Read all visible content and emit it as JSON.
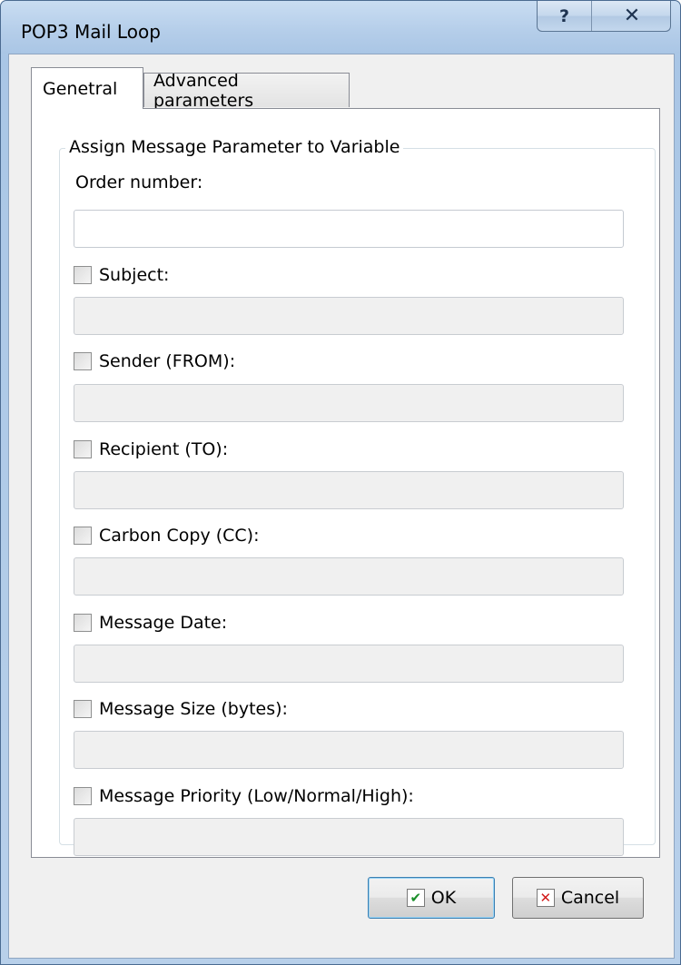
{
  "window": {
    "title": "POP3 Mail Loop",
    "help_glyph": "?",
    "close_glyph": "✕"
  },
  "tabs": [
    {
      "label": "Genetral",
      "active": true
    },
    {
      "label": "Advanced parameters",
      "active": false
    }
  ],
  "group": {
    "legend": "Assign Message Parameter to Variable",
    "order_number": {
      "label": "Order number:",
      "value": ""
    },
    "fields": [
      {
        "label": "Subject:",
        "checked": false,
        "value": ""
      },
      {
        "label": "Sender (FROM):",
        "checked": false,
        "value": ""
      },
      {
        "label": "Recipient (TO):",
        "checked": false,
        "value": ""
      },
      {
        "label": "Carbon Copy (CC):",
        "checked": false,
        "value": ""
      },
      {
        "label": "Message Date:",
        "checked": false,
        "value": ""
      },
      {
        "label": "Message Size (bytes):",
        "checked": false,
        "value": ""
      },
      {
        "label": "Message Priority (Low/Normal/High):",
        "checked": false,
        "value": ""
      }
    ]
  },
  "buttons": {
    "ok": {
      "label": "OK",
      "icon": "check-icon"
    },
    "cancel": {
      "label": "Cancel",
      "icon": "x-icon"
    }
  },
  "colors": {
    "title_bar": "#b4cde9",
    "client_bg": "#f0f0f0",
    "ok_icon": "#1a8f2a",
    "cancel_icon": "#d21a1a"
  }
}
